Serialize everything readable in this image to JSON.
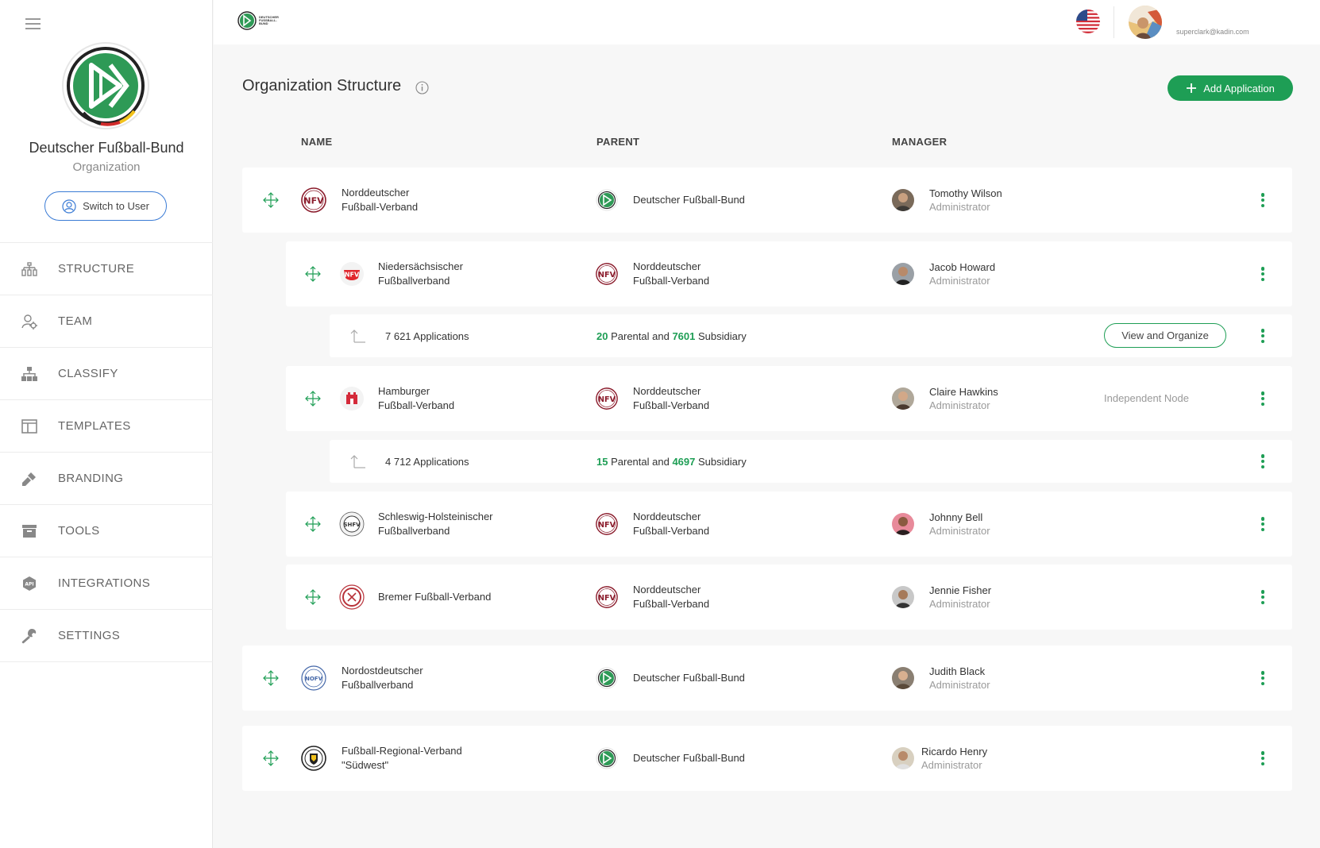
{
  "sidebar": {
    "org_name": "Deutscher Fußball-Bund",
    "org_type": "Organization",
    "switch_label": "Switch to User",
    "nav": [
      {
        "label": "STRUCTURE",
        "icon": "structure-icon"
      },
      {
        "label": "TEAM",
        "icon": "team-icon"
      },
      {
        "label": "CLASSIFY",
        "icon": "classify-icon"
      },
      {
        "label": "TEMPLATES",
        "icon": "templates-icon"
      },
      {
        "label": "BRANDING",
        "icon": "branding-icon"
      },
      {
        "label": "TOOLS",
        "icon": "tools-icon"
      },
      {
        "label": "INTEGRATIONS",
        "icon": "integrations-icon"
      },
      {
        "label": "SETTINGS",
        "icon": "settings-icon"
      }
    ]
  },
  "topbar": {
    "logo_text": "DEUTSCHER FUSSBALL-BUND",
    "email": "superclark@kadin.com"
  },
  "main": {
    "title": "Organization Structure",
    "add_label": "Add Application",
    "columns": {
      "name": "NAME",
      "parent": "PARENT",
      "manager": "MANAGER"
    }
  },
  "rows": [
    {
      "name": "Norddeutscher\nFußball-Verband",
      "parent": "Deutscher Fußball-Bund",
      "manager": "Tomothy Wilson",
      "role": "Administrator"
    },
    {
      "name": "Niedersächsischer\nFußballverband",
      "parent": "Norddeutscher\nFußball-Verband",
      "manager": "Jacob Howard",
      "role": "Administrator"
    },
    {
      "apps": "7 621 Applications",
      "parental": "20",
      "parental_text": "Parental and",
      "subsidiary": "7601",
      "subsidiary_text": "Subsidiary",
      "action": "View and Organize"
    },
    {
      "name": "Hamburger\nFußball-Verband",
      "parent": "Norddeutscher\nFußball-Verband",
      "manager": "Claire Hawkins",
      "role": "Administrator",
      "note": "Independent Node"
    },
    {
      "apps": "4 712 Applications",
      "parental": "15",
      "parental_text": "Parental and",
      "subsidiary": "4697",
      "subsidiary_text": "Subsidiary"
    },
    {
      "name": "Schleswig-Holsteinischer\nFußballverband",
      "parent": "Norddeutscher\nFußball-Verband",
      "manager": "Johnny Bell",
      "role": "Administrator"
    },
    {
      "name": "Bremer Fußball-Verband",
      "parent": "Norddeutscher\nFußball-Verband",
      "manager": "Jennie Fisher",
      "role": "Administrator"
    },
    {
      "name": "Nordostdeutscher\nFußballverband",
      "parent": "Deutscher Fußball-Bund",
      "manager": "Judith Black",
      "role": "Administrator"
    },
    {
      "name": "Fußball-Regional-Verband\n\"Südwest\"",
      "parent": "Deutscher Fußball-Bund",
      "manager": "Ricardo Henry",
      "role": "Administrator"
    }
  ],
  "colors": {
    "accent": "#1e9e55",
    "link_blue": "#3a7bd5",
    "nfv_red": "#8b1c2c"
  }
}
